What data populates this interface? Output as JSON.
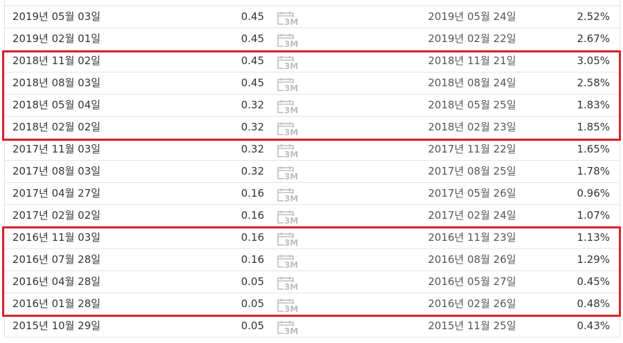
{
  "icon": {
    "name": "calendar-3m-icon",
    "text": "3M",
    "color": "#bdbdbd"
  },
  "highlight_color": "#d8222a",
  "rows": [
    {
      "ex_date": "2019년 05월 03일",
      "amount": "0.45",
      "pay_date": "2019년 05월 24일",
      "yield": "2.52%"
    },
    {
      "ex_date": "2019년 02월 01일",
      "amount": "0.45",
      "pay_date": "2019년 02월 22일",
      "yield": "2.67%"
    },
    {
      "ex_date": "2018년 11월 02일",
      "amount": "0.45",
      "pay_date": "2018년 11월 21일",
      "yield": "3.05%"
    },
    {
      "ex_date": "2018년 08월 03일",
      "amount": "0.45",
      "pay_date": "2018년 08월 24일",
      "yield": "2.58%"
    },
    {
      "ex_date": "2018년 05월 04일",
      "amount": "0.32",
      "pay_date": "2018년 05월 25일",
      "yield": "1.83%"
    },
    {
      "ex_date": "2018년 02월 02일",
      "amount": "0.32",
      "pay_date": "2018년 02월 23일",
      "yield": "1.85%"
    },
    {
      "ex_date": "2017년 11월 03일",
      "amount": "0.32",
      "pay_date": "2017년 11월 22일",
      "yield": "1.65%"
    },
    {
      "ex_date": "2017년 08월 03일",
      "amount": "0.32",
      "pay_date": "2017년 08월 25일",
      "yield": "1.78%"
    },
    {
      "ex_date": "2017년 04월 27일",
      "amount": "0.16",
      "pay_date": "2017년 05월 26일",
      "yield": "0.96%"
    },
    {
      "ex_date": "2017년 02월 02일",
      "amount": "0.16",
      "pay_date": "2017년 02월 24일",
      "yield": "1.07%"
    },
    {
      "ex_date": "2016년 11월 03일",
      "amount": "0.16",
      "pay_date": "2016년 11월 23일",
      "yield": "1.13%"
    },
    {
      "ex_date": "2016년 07월 28일",
      "amount": "0.16",
      "pay_date": "2016년 08월 26일",
      "yield": "1.29%"
    },
    {
      "ex_date": "2016년 04월 28일",
      "amount": "0.05",
      "pay_date": "2016년 05월 27일",
      "yield": "0.45%"
    },
    {
      "ex_date": "2016년 01월 28일",
      "amount": "0.05",
      "pay_date": "2016년 02월 26일",
      "yield": "0.48%"
    },
    {
      "ex_date": "2015년 10월 29일",
      "amount": "0.05",
      "pay_date": "2015년 11월 25일",
      "yield": "0.43%"
    }
  ]
}
